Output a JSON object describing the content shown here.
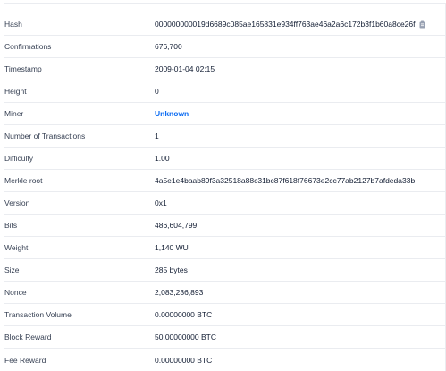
{
  "block_details": {
    "rows": [
      {
        "label": "Hash",
        "value": "000000000019d6689c085ae165831e934ff763ae46a2a6c172b3f1b60a8ce26f"
      },
      {
        "label": "Confirmations",
        "value": "676,700"
      },
      {
        "label": "Timestamp",
        "value": "2009-01-04 02:15"
      },
      {
        "label": "Height",
        "value": "0"
      },
      {
        "label": "Miner",
        "value": "Unknown"
      },
      {
        "label": "Number of Transactions",
        "value": "1"
      },
      {
        "label": "Difficulty",
        "value": "1.00"
      },
      {
        "label": "Merkle root",
        "value": "4a5e1e4baab89f3a32518a88c31bc87f618f76673e2cc77ab2127b7afdeda33b"
      },
      {
        "label": "Version",
        "value": "0x1"
      },
      {
        "label": "Bits",
        "value": "486,604,799"
      },
      {
        "label": "Weight",
        "value": "1,140 WU"
      },
      {
        "label": "Size",
        "value": "285 bytes"
      },
      {
        "label": "Nonce",
        "value": "2,083,236,893"
      },
      {
        "label": "Transaction Volume",
        "value": "0.00000000 BTC"
      },
      {
        "label": "Block Reward",
        "value": "50.00000000 BTC"
      },
      {
        "label": "Fee Reward",
        "value": "0.00000000 BTC"
      }
    ],
    "copy_icon": "copy-icon",
    "link_color": "#0c6cf2"
  }
}
